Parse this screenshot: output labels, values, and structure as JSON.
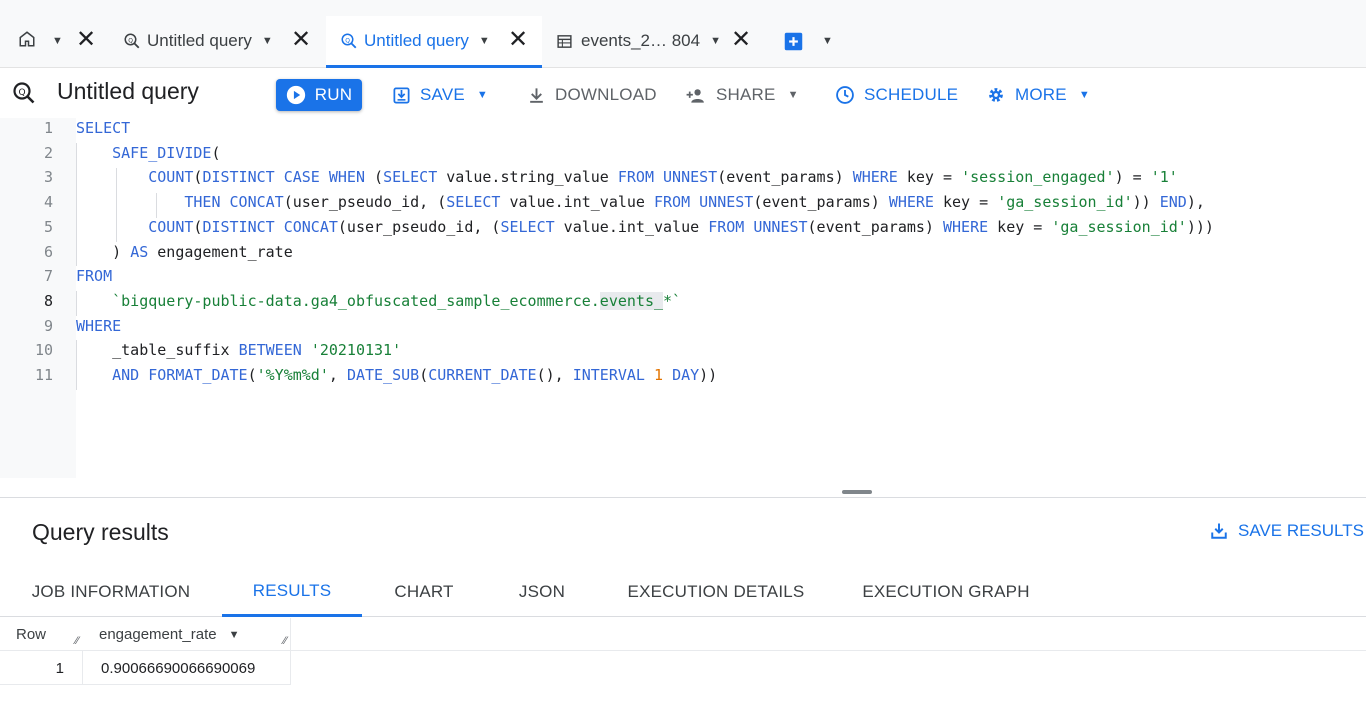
{
  "tabs": [
    {
      "label": "Untitled query",
      "active": false
    },
    {
      "label": "Untitled query",
      "active": true
    },
    {
      "label": "events_2… 804",
      "active": false
    }
  ],
  "toolbar": {
    "title": "Untitled query",
    "run_label": "RUN",
    "save_label": "SAVE",
    "download_label": "DOWNLOAD",
    "share_label": "SHARE",
    "schedule_label": "SCHEDULE",
    "more_label": "MORE"
  },
  "editor": {
    "current_line": 8,
    "lines": [
      {
        "n": "1",
        "text": "SELECT"
      },
      {
        "n": "2",
        "text": "    SAFE_DIVIDE("
      },
      {
        "n": "3",
        "text": "        COUNT(DISTINCT CASE WHEN (SELECT value.string_value FROM UNNEST(event_params) WHERE key = 'session_engaged') = '1'"
      },
      {
        "n": "4",
        "text": "            THEN CONCAT(user_pseudo_id, (SELECT value.int_value FROM UNNEST(event_params) WHERE key = 'ga_session_id')) END),"
      },
      {
        "n": "5",
        "text": "        COUNT(DISTINCT CONCAT(user_pseudo_id, (SELECT value.int_value FROM UNNEST(event_params) WHERE key = 'ga_session_id')))"
      },
      {
        "n": "6",
        "text": "    ) AS engagement_rate"
      },
      {
        "n": "7",
        "text": "FROM"
      },
      {
        "n": "8",
        "text": "    `bigquery-public-data.ga4_obfuscated_sample_ecommerce.events_*`"
      },
      {
        "n": "9",
        "text": "WHERE"
      },
      {
        "n": "10",
        "text": "    _table_suffix BETWEEN '20210131'"
      },
      {
        "n": "11",
        "text": "    AND FORMAT_DATE('%Y%m%d', DATE_SUB(CURRENT_DATE(), INTERVAL 1 DAY))"
      }
    ]
  },
  "results": {
    "title": "Query results",
    "save_results_label": "SAVE RESULTS",
    "tabs": [
      "JOB INFORMATION",
      "RESULTS",
      "CHART",
      "JSON",
      "EXECUTION DETAILS",
      "EXECUTION GRAPH"
    ],
    "active_tab": "RESULTS",
    "columns": [
      "Row",
      "engagement_rate"
    ],
    "rows": [
      {
        "row": "1",
        "engagement_rate": "0.90066690066690069"
      }
    ]
  },
  "colors": {
    "accent": "#1a73e8",
    "keyword": "#3367d6",
    "string": "#188038",
    "number": "#e37400"
  }
}
